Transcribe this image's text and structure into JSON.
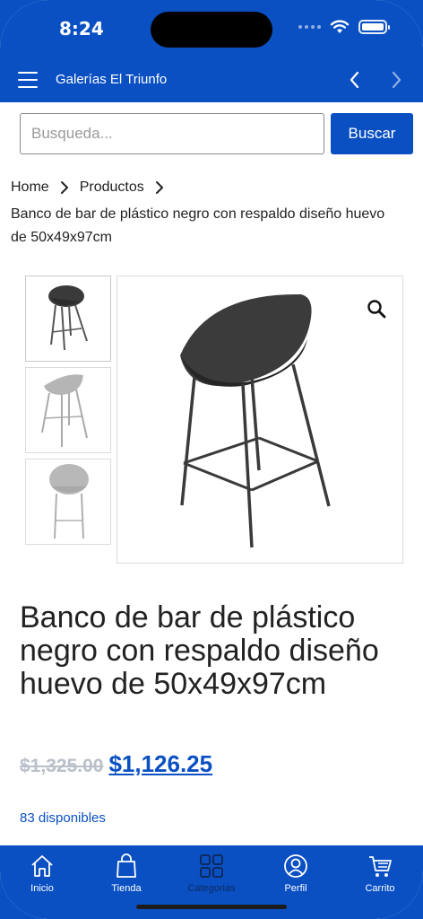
{
  "status_bar": {
    "time": "8:24"
  },
  "header": {
    "title": "Galerías El Triunfo",
    "menu_icon": "hamburger-icon",
    "back_icon": "chevron-left-icon",
    "forward_icon": "chevron-right-icon"
  },
  "search": {
    "placeholder": "Busqueda...",
    "value": "",
    "button_label": "Buscar"
  },
  "breadcrumb": {
    "items": [
      "Home",
      "Productos"
    ],
    "current": "Banco de bar de plástico negro con respaldo diseño huevo de 50x49x97cm"
  },
  "gallery": {
    "thumbnails": [
      "chair-black",
      "chair-white-back",
      "chair-white-front"
    ],
    "zoom_icon": "magnifier-icon"
  },
  "product": {
    "title": "Banco de bar de plástico negro con respaldo diseño huevo de 50x49x97cm",
    "old_price": "$1,325.00",
    "price": "$1,126.25",
    "stock": "83 disponibles"
  },
  "tabbar": {
    "items": [
      {
        "label": "Inicio",
        "icon": "home-icon"
      },
      {
        "label": "Tienda",
        "icon": "shopping-bag-icon"
      },
      {
        "label": "Categorias",
        "icon": "grid-icon"
      },
      {
        "label": "Perfil",
        "icon": "user-icon"
      },
      {
        "label": "Carrito",
        "icon": "cart-icon"
      }
    ],
    "active": "Categorias"
  },
  "colors": {
    "brand": "#0a50c2",
    "text": "#222222",
    "old_price": "#b9c0c9",
    "active_tab_label": "#0d2a5e"
  }
}
